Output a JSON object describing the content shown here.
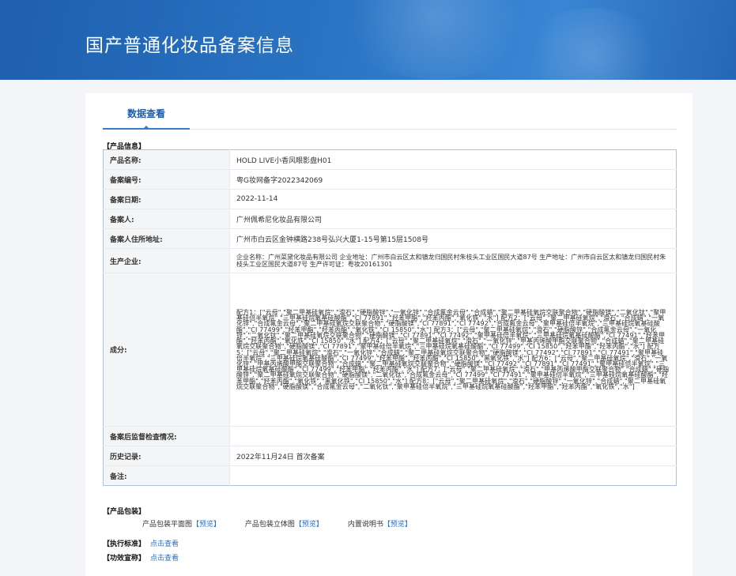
{
  "page": {
    "title": "国产普通化妆品备案信息"
  },
  "tabs": [
    {
      "label": "数据查看"
    }
  ],
  "product_info": {
    "section_label": "【产品信息】",
    "rows": [
      {
        "label": "产品名称:",
        "value": "HOLD LIVE小香风眼影盘H01"
      },
      {
        "label": "备案编号:",
        "value": "粤G妆网备字2022342069"
      },
      {
        "label": "备案日期:",
        "value": "2022-11-14"
      },
      {
        "label": "备案人:",
        "value": "广州佩希尼化妆品有限公司"
      },
      {
        "label": "备案人住所地址:",
        "value": "广州市白云区金钟横路238号弘兴大厦1-15号第15层1508号"
      },
      {
        "label": "生产企业:",
        "value": "企业名称：广州菜黛化妆品有限公司 企业地址：广州市白云区太和镇龙归国民村朱枝头工业区国民大道87号 生产地址：广州市白云区太和镇龙归国民村朱枝头工业区国民大道87号 生产许可证：粤妆20161301"
      },
      {
        "label": "成分:",
        "value": "配方1：[\"云母\",\"聚二甲基硅氧烷\",\"滑石\",\"硬脂酸锌\",\"一氧化锌\",\"合成氟金云母\",\"合成蜡\",\"聚二甲基硅氧烷交联聚合物\",\"硬脂酸镁\",\"二氧化钛\",\"聚甲基硅倍半氧烷\",\"三甲基硅烷氧基硅酸酯\",\"CI 77891\",\"羟苯甲酯\",\"羟苯丙酯\",\"氧化铁\",\"水\"] 配方2：[\"云母\",\"聚二甲基硅氧烷\",\"滑石\",\"合成蜡\",\"一氧化锌\",\"合成氟金云母\",\"聚二甲基硅氧烷交联聚合物\",\"硬脂酸镁\",\"CI 77891\",\"CI 77492\",\"合成氟金云母\",\"聚甲基硅倍半氧烷\",\"三甲基硅烷氧基硅酸酯\",\"CI 77499\",\"羟苯甲酯\",\"羟苯丙酯\",\"氧化铁\",\"CI 15850\",\"水\"] 配方3：[\"云母\",\"聚二甲基硅氧烷\",\"滑石\",\"硬脂酸锌\",\"合成氟金云母\",\"一氧化锌\",\"二氧化钛\",\"聚二甲基硅氧烷交联聚合物\",\"硬脂酸镁\",\"CI 77891\",\"CI 77492\",\"聚甲基硅倍半氧烷\",\"三甲基硅烷氧基硅酸酯\",\"CI 77491\",\"羟苯甲酯\",\"羟苯丙酯\",\"氧化铁\",\"CI 15850\",\"水\"] 配方4：[\"云母\",\"聚二甲基硅氧烷\",\"滑石\",\"一氧化锌\",\"甲基丙烯酸甲酯交联聚合物\",\"合成蜡\",\"聚二甲基硅氧烷交联聚合物\",\"硬脂酸镁\",\"CI 77891\",\"聚甲基硅倍半氧烷\",\"三甲基硅烷氧基硅酸酯\",\"CI 77499\",\"CI 15850\",\"羟苯甲酯\",\"羟苯丙酯\",\"水\"] 配方5：[\"云母\",\"聚二甲基硅氧烷\",\"滑石\",\"一氧化锌\",\"合成蜡\",\"聚二甲基硅氧烷交联聚合物\",\"硬脂酸镁\",\"CI 77492\",\"CI 77891\",\"CI 77491\",\"聚甲基硅倍半氧烷\",\"三甲基硅烷氧基硅酸酯\",\"CI 77499\",\"羟苯甲酯\",\"羟苯丙酯\",\"CI 15850\",\"黑氧化铁\",\"水\"] 配方6：[\"云母\",\"聚二甲基硅氧烷\",\"滑石\",\"一氧化锌\",\"甲基丙烯酸甲酯交联聚合物\",\"合成蜡\",\"聚二甲基硅氧烷交联聚合物\",\"硬脂酸镁\",\"CI 77492\",\"CI 77891\",\"CI 77491\",\"聚甲基硅倍半氧烷\",\"三甲基硅烷氧基硅酸酯\",\"CI 77499\",\"羟苯甲酯\",\"羟苯丙酯\",\"水\"] 配方7：[\"云母\",\"聚二甲基硅氧烷\",\"滑石\",\"甲基丙烯酸甲酯交联聚合物\",\"合成蜡\",\"硬脂酸锌\",\"聚二甲基硅氧烷交联聚合物\",\"硬脂酸镁\",\"二氧化钛\",\"合成氟金云母\",\"CI 77499\",\"CI 77491\",\"聚甲基硅倍半氧烷\",\"三甲基硅烷氧基硅酸酯\",\"羟苯甲酯\",\"羟苯丙酯\",\"氧化铁\",\"黑氧化铁\",\"CI 15850\",\"水\"] 配方8：[\"云母\",\"聚二甲基硅氧烷\",\"滑石\",\"硬脂酸锌\",\"一氧化锌\",\"合成蜡\",\"聚二甲基硅氧烷交联聚合物\",\"硬脂酸镁\",\"合成氟金云母\",\"二氧化钛\",\"聚甲基硅倍半氧烷\",\"三甲基硅烷氧基硅酸酯\",\"羟苯甲酯\",\"羟苯丙酯\",\"氧化铁\",\"水\"]"
      },
      {
        "label": "备案后监督检查情况:",
        "value": ""
      },
      {
        "label": "历史记录:",
        "value": "2022年11月24日 首次备案"
      },
      {
        "label": "备注:",
        "value": ""
      }
    ]
  },
  "packaging": {
    "section_label": "【产品包装】",
    "items": [
      {
        "label": "产品包装平面图",
        "link": "【预览】"
      },
      {
        "label": "产品包装立体图",
        "link": "【预览】"
      },
      {
        "label": "内置说明书",
        "link": "【预览】"
      }
    ]
  },
  "standards": {
    "exec_label": "【执行标准】",
    "exec_link": "点击查看",
    "claim_label": "【功效宣称】",
    "claim_link": "点击查看"
  },
  "colors": {
    "banner": "#2a74c4",
    "tab_accent": "#3b7cc9",
    "table_border": "#a9c3e0",
    "link": "#2f6fc0"
  }
}
